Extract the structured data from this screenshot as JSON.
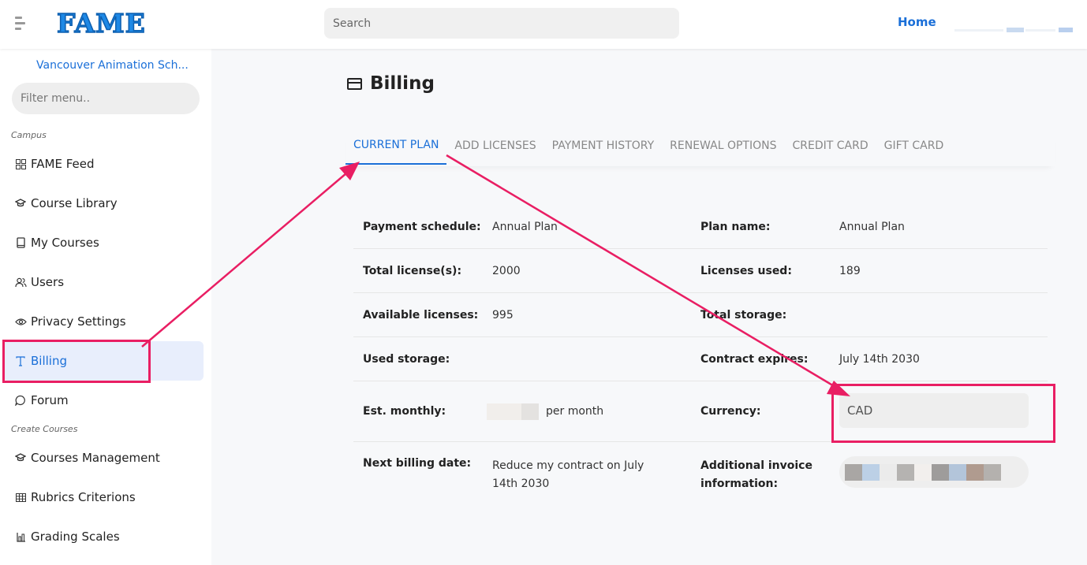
{
  "header": {
    "logo": "FAME",
    "search_placeholder": "Search",
    "home_link": "Home"
  },
  "sidebar": {
    "org_name": "Vancouver Animation Sch...",
    "filter_placeholder": "Filter menu..",
    "section_campus": "Campus",
    "section_create": "Create Courses",
    "items": [
      {
        "label": "FAME Feed",
        "icon": "grid-icon"
      },
      {
        "label": "Course Library",
        "icon": "graduation-cap-icon"
      },
      {
        "label": "My Courses",
        "icon": "book-icon"
      },
      {
        "label": "Users",
        "icon": "users-icon"
      },
      {
        "label": "Privacy Settings",
        "icon": "eye-icon"
      },
      {
        "label": "Billing",
        "icon": "text-t-icon"
      },
      {
        "label": "Forum",
        "icon": "chat-bubble-icon"
      },
      {
        "label": "Courses Management",
        "icon": "graduation-cap-icon"
      },
      {
        "label": "Rubrics Criterions",
        "icon": "table-icon"
      },
      {
        "label": "Grading Scales",
        "icon": "scale-icon"
      }
    ]
  },
  "main": {
    "title": "Billing",
    "tabs": [
      "CURRENT PLAN",
      "ADD LICENSES",
      "PAYMENT HISTORY",
      "RENEWAL OPTIONS",
      "CREDIT CARD",
      "GIFT CARD"
    ],
    "rows": [
      {
        "l1": "Payment schedule:",
        "v1": "Annual Plan",
        "l2": "Plan name:",
        "v2": "Annual Plan"
      },
      {
        "l1": "Total license(s):",
        "v1": "2000",
        "l2": "Licenses used:",
        "v2": "189"
      },
      {
        "l1": "Available licenses:",
        "v1": "995",
        "l2": "Total storage:",
        "v2": ""
      },
      {
        "l1": "Used storage:",
        "v1": "",
        "l2": "Contract expires:",
        "v2": "July 14th 2030"
      },
      {
        "l1": "Est. monthly:",
        "v1_suffix": "per month",
        "l2": "Currency:",
        "v2": "CAD"
      },
      {
        "l1": "Next billing date:",
        "v1": "Reduce my contract on July 14th 2030",
        "l2": "Additional invoice information:"
      }
    ]
  },
  "colors": {
    "accent": "#1a6fd8",
    "annotation": "#e91e63"
  }
}
